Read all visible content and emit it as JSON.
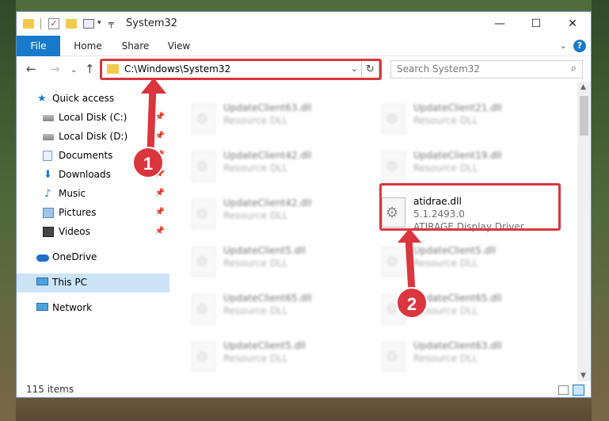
{
  "window": {
    "title": "System32",
    "controls": {
      "minimize": "—",
      "maximize": "☐",
      "close": "✕"
    }
  },
  "quick_access_toolbar": {
    "dropdown": "▾",
    "more": "╤"
  },
  "ribbon": {
    "tabs": [
      {
        "label": "File"
      },
      {
        "label": "Home"
      },
      {
        "label": "Share"
      },
      {
        "label": "View"
      }
    ],
    "collapse": "⌄",
    "help": "?"
  },
  "nav": {
    "back": "←",
    "forward": "→",
    "recent": "⌄",
    "up": "↑",
    "address": "C:\\Windows\\System32",
    "address_dropdown": "⌄",
    "refresh": "↻",
    "search_placeholder": "Search System32",
    "search_icon": "⌕"
  },
  "sidebar": {
    "items": [
      {
        "label": "Quick access",
        "icon": "star-icon"
      },
      {
        "label": "Local Disk (C:)",
        "icon": "drive-icon",
        "pin": "📌"
      },
      {
        "label": "Local Disk (D:)",
        "icon": "drive-icon",
        "pin": "📌"
      },
      {
        "label": "Documents",
        "icon": "documents-icon",
        "pin": "📌"
      },
      {
        "label": "Downloads",
        "icon": "downloads-icon",
        "pin": "📌"
      },
      {
        "label": "Music",
        "icon": "music-icon",
        "pin": "📌"
      },
      {
        "label": "Pictures",
        "icon": "pictures-icon",
        "pin": "📌"
      },
      {
        "label": "Videos",
        "icon": "videos-icon",
        "pin": "📌"
      },
      {
        "label": "OneDrive",
        "icon": "cloud-icon"
      },
      {
        "label": "This PC",
        "icon": "computer-icon",
        "selected": true
      },
      {
        "label": "Network",
        "icon": "network-icon"
      }
    ],
    "icon_glyphs": {
      "star": "★",
      "downloads": "⬇",
      "music": "♪"
    }
  },
  "files": {
    "left_column": [
      {
        "name": "UpdateClient63.dll",
        "type": "Resource DLL"
      },
      {
        "name": "UpdateClient42.dll",
        "type": "Resource DLL"
      },
      {
        "name": "UpdateClient42.dll",
        "type": "Resource DLL"
      },
      {
        "name": "UpdateClient5.dll",
        "type": "Resource DLL"
      },
      {
        "name": "UpdateClient65.dll",
        "type": "Resource DLL"
      },
      {
        "name": "UpdateClient5.dll",
        "type": "Resource DLL"
      }
    ],
    "right_column": [
      {
        "name": "UpdateClient21.dll",
        "type": "Resource DLL"
      },
      {
        "name": "UpdateClient19.dll",
        "type": "Resource DLL"
      },
      {
        "name": "atidrae.dll",
        "version": "5.1.2493.0",
        "description": "ATIRAGE Display Driver",
        "highlighted": true
      },
      {
        "name": "UpdateClient5.dll",
        "type": "Resource DLL"
      },
      {
        "name": "UpdateClient65.dll",
        "type": "Resource DLL"
      },
      {
        "name": "UpdateClient63.dll",
        "type": "Resource DLL"
      }
    ]
  },
  "scrollbar": {
    "up": "▲",
    "down": "▼"
  },
  "status": {
    "item_count": "115 items"
  },
  "annotations": {
    "step1": "1",
    "step2": "2",
    "color": "#d9363e"
  }
}
